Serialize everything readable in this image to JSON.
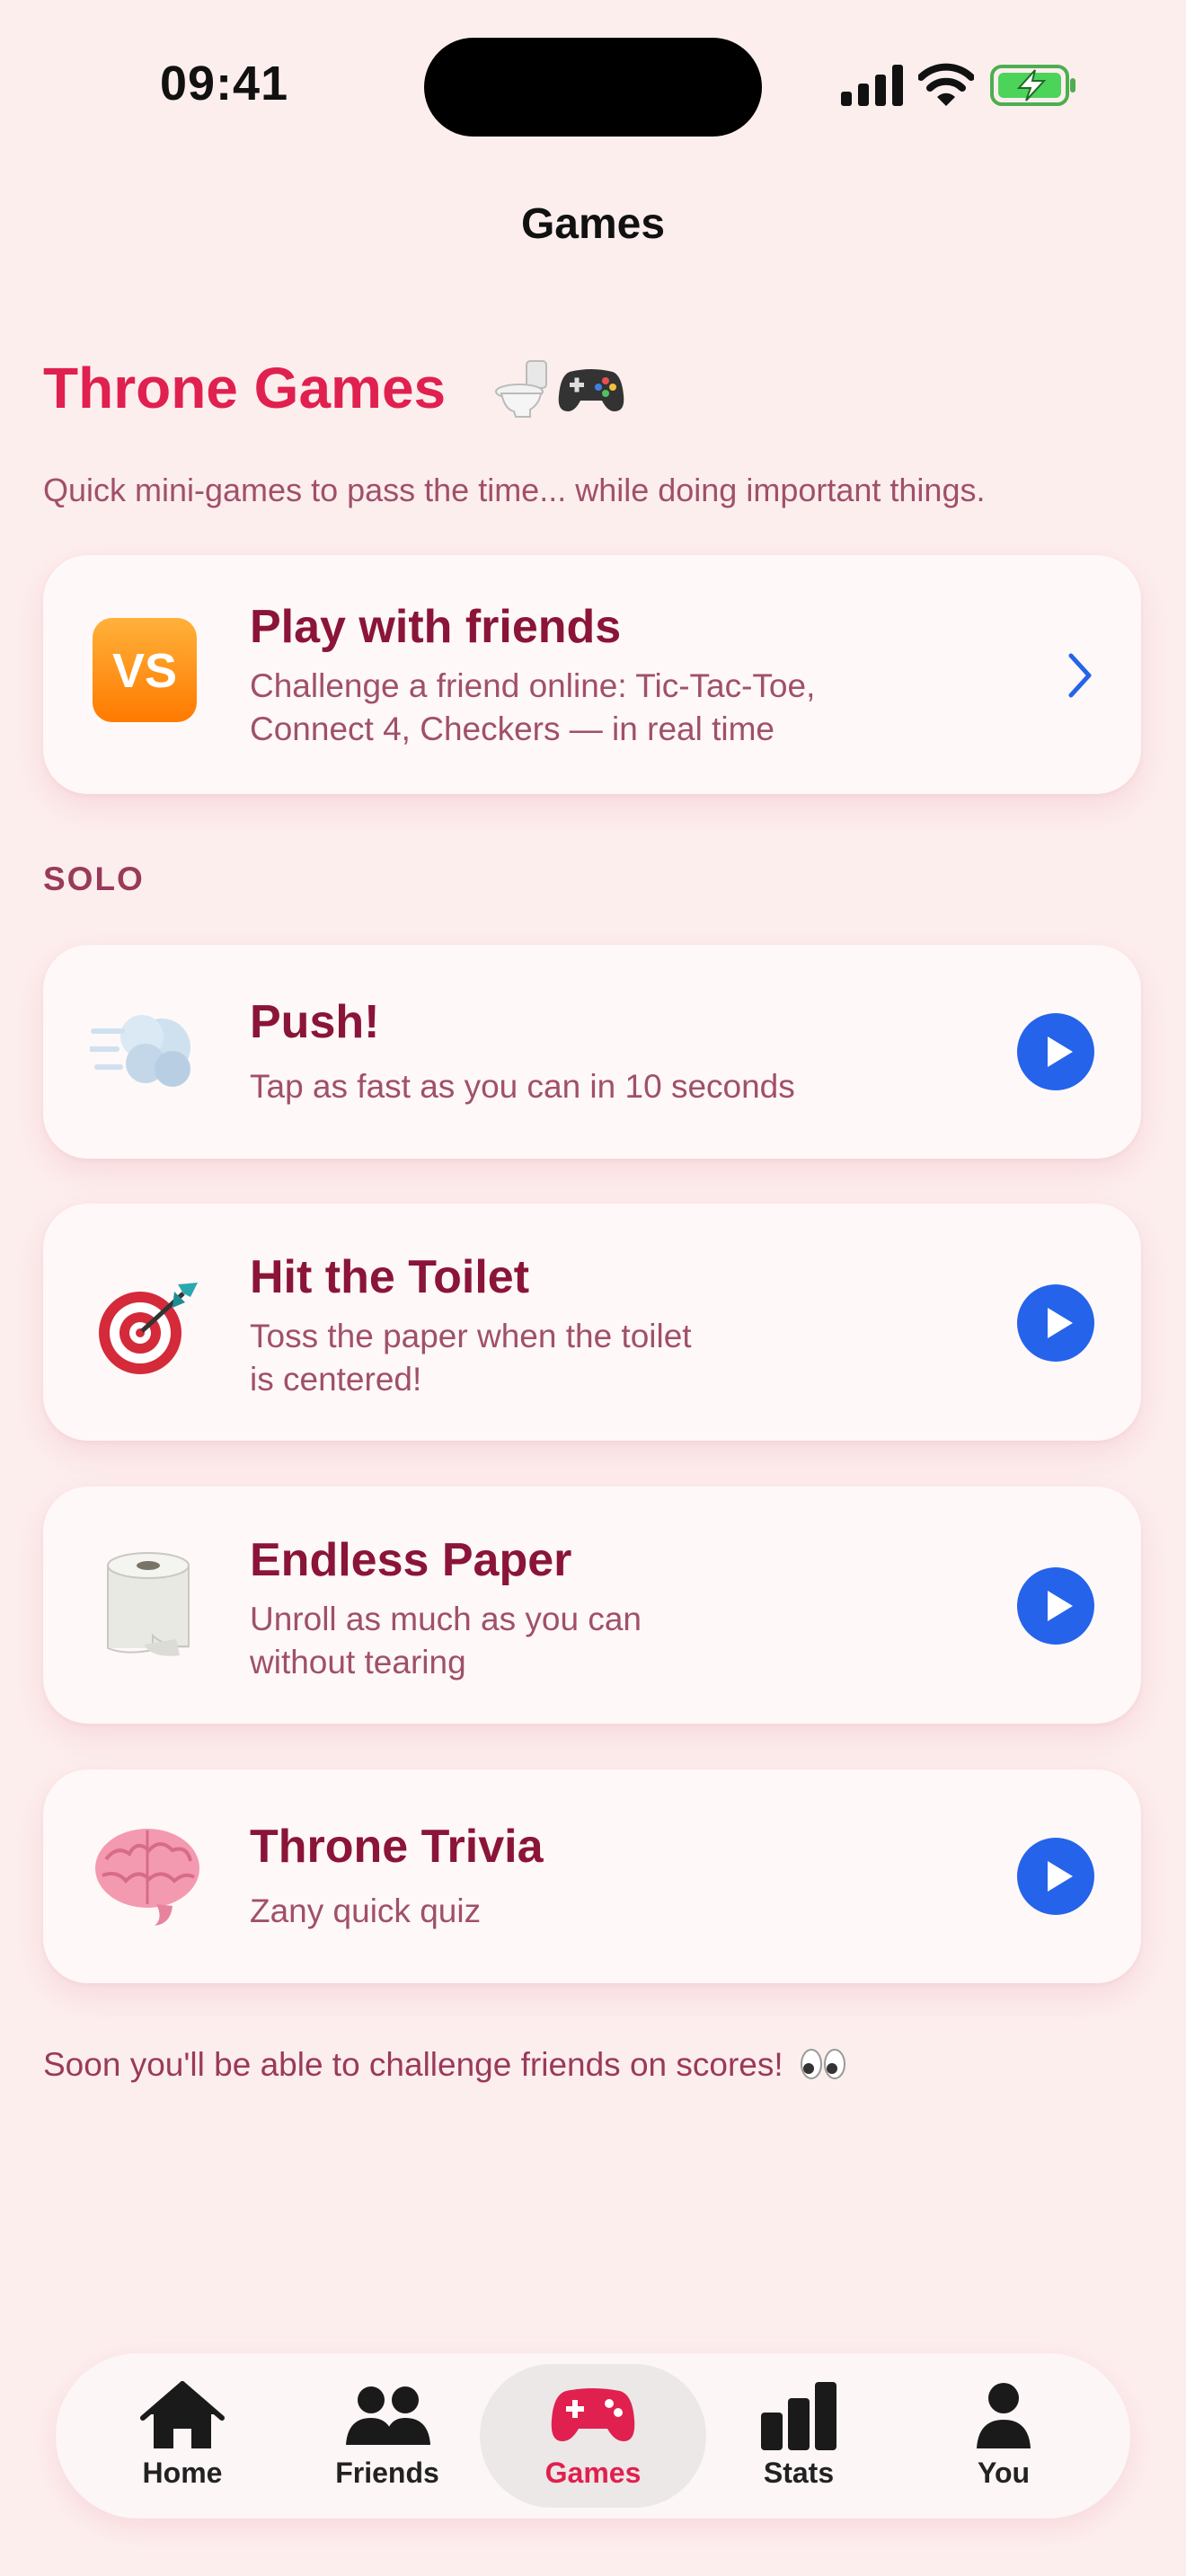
{
  "status": {
    "time": "09:41"
  },
  "nav": {
    "title": "Games"
  },
  "hero": {
    "title": "Throne Games",
    "subtitle": "Quick mini-games to pass the time... while doing important things."
  },
  "friends_card": {
    "badge": "VS",
    "title": "Play with friends",
    "description": "Challenge a friend online: Tic-Tac-Toe,\nConnect 4, Checkers — in real time"
  },
  "section_label": "SOLO",
  "games": [
    {
      "icon": "wind-icon",
      "title": "Push!",
      "description": "Tap as fast as you can in 10 seconds"
    },
    {
      "icon": "target-dart-icon",
      "title": "Hit the Toilet",
      "description": "Toss the paper when the toilet\nis centered!"
    },
    {
      "icon": "toilet-paper-icon",
      "title": "Endless Paper",
      "description": "Unroll as much as you can\nwithout tearing"
    },
    {
      "icon": "brain-icon",
      "title": "Throne Trivia",
      "description": "Zany quick quiz"
    }
  ],
  "footer_note": "Soon you'll be able to challenge friends on scores!",
  "tabs": [
    {
      "label": "Home",
      "icon": "house-icon"
    },
    {
      "label": "Friends",
      "icon": "people-icon"
    },
    {
      "label": "Games",
      "icon": "gamepad-icon",
      "active": true
    },
    {
      "label": "Stats",
      "icon": "bar-chart-icon"
    },
    {
      "label": "You",
      "icon": "person-icon"
    }
  ],
  "colors": {
    "accent": "#e0204e",
    "title_dark": "#8a1538",
    "play_blue": "#2563eb",
    "background": "#fdeeee"
  }
}
